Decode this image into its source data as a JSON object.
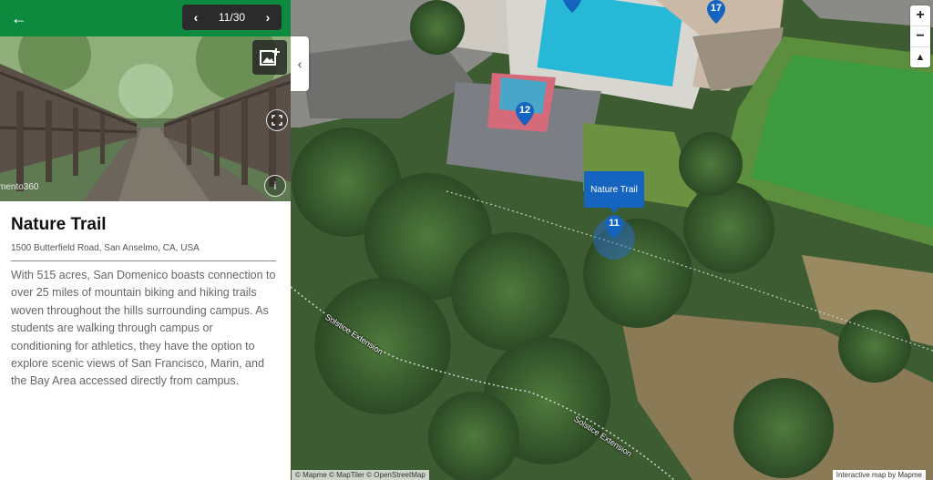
{
  "panel": {
    "pager": {
      "text": "11/30"
    },
    "place": {
      "title": "Nature Trail",
      "address": "1500 Butterfield Road, San Anselmo, CA, USA",
      "description": "With 515 acres, San Domenico boasts connection to over 25 miles of mountain biking and hiking trails woven throughout the hills surrounding campus. As students are walking through campus or conditioning for athletics, they have the option to explore scenic views of San Francisco, Marin, and the Bay Area accessed directly from campus."
    },
    "photo_watermark": "mento360"
  },
  "map": {
    "markers": [
      {
        "id": "17",
        "label": "17"
      },
      {
        "id": "12",
        "label": "12"
      },
      {
        "id": "11",
        "label": "11"
      }
    ],
    "selected_callout": "Nature Trail",
    "road_labels": [
      "Solstice Extension",
      "Solstice Extension"
    ],
    "zoom": {
      "in": "+",
      "out": "−",
      "compass": "▲"
    },
    "attribution_left": "© Mapme © MapTiler © OpenStreetMap",
    "attribution_right": "Interactive map by Mapme",
    "marker_color": "#1565c0"
  },
  "theme": {
    "topbar_color": "#0e8a3e"
  }
}
